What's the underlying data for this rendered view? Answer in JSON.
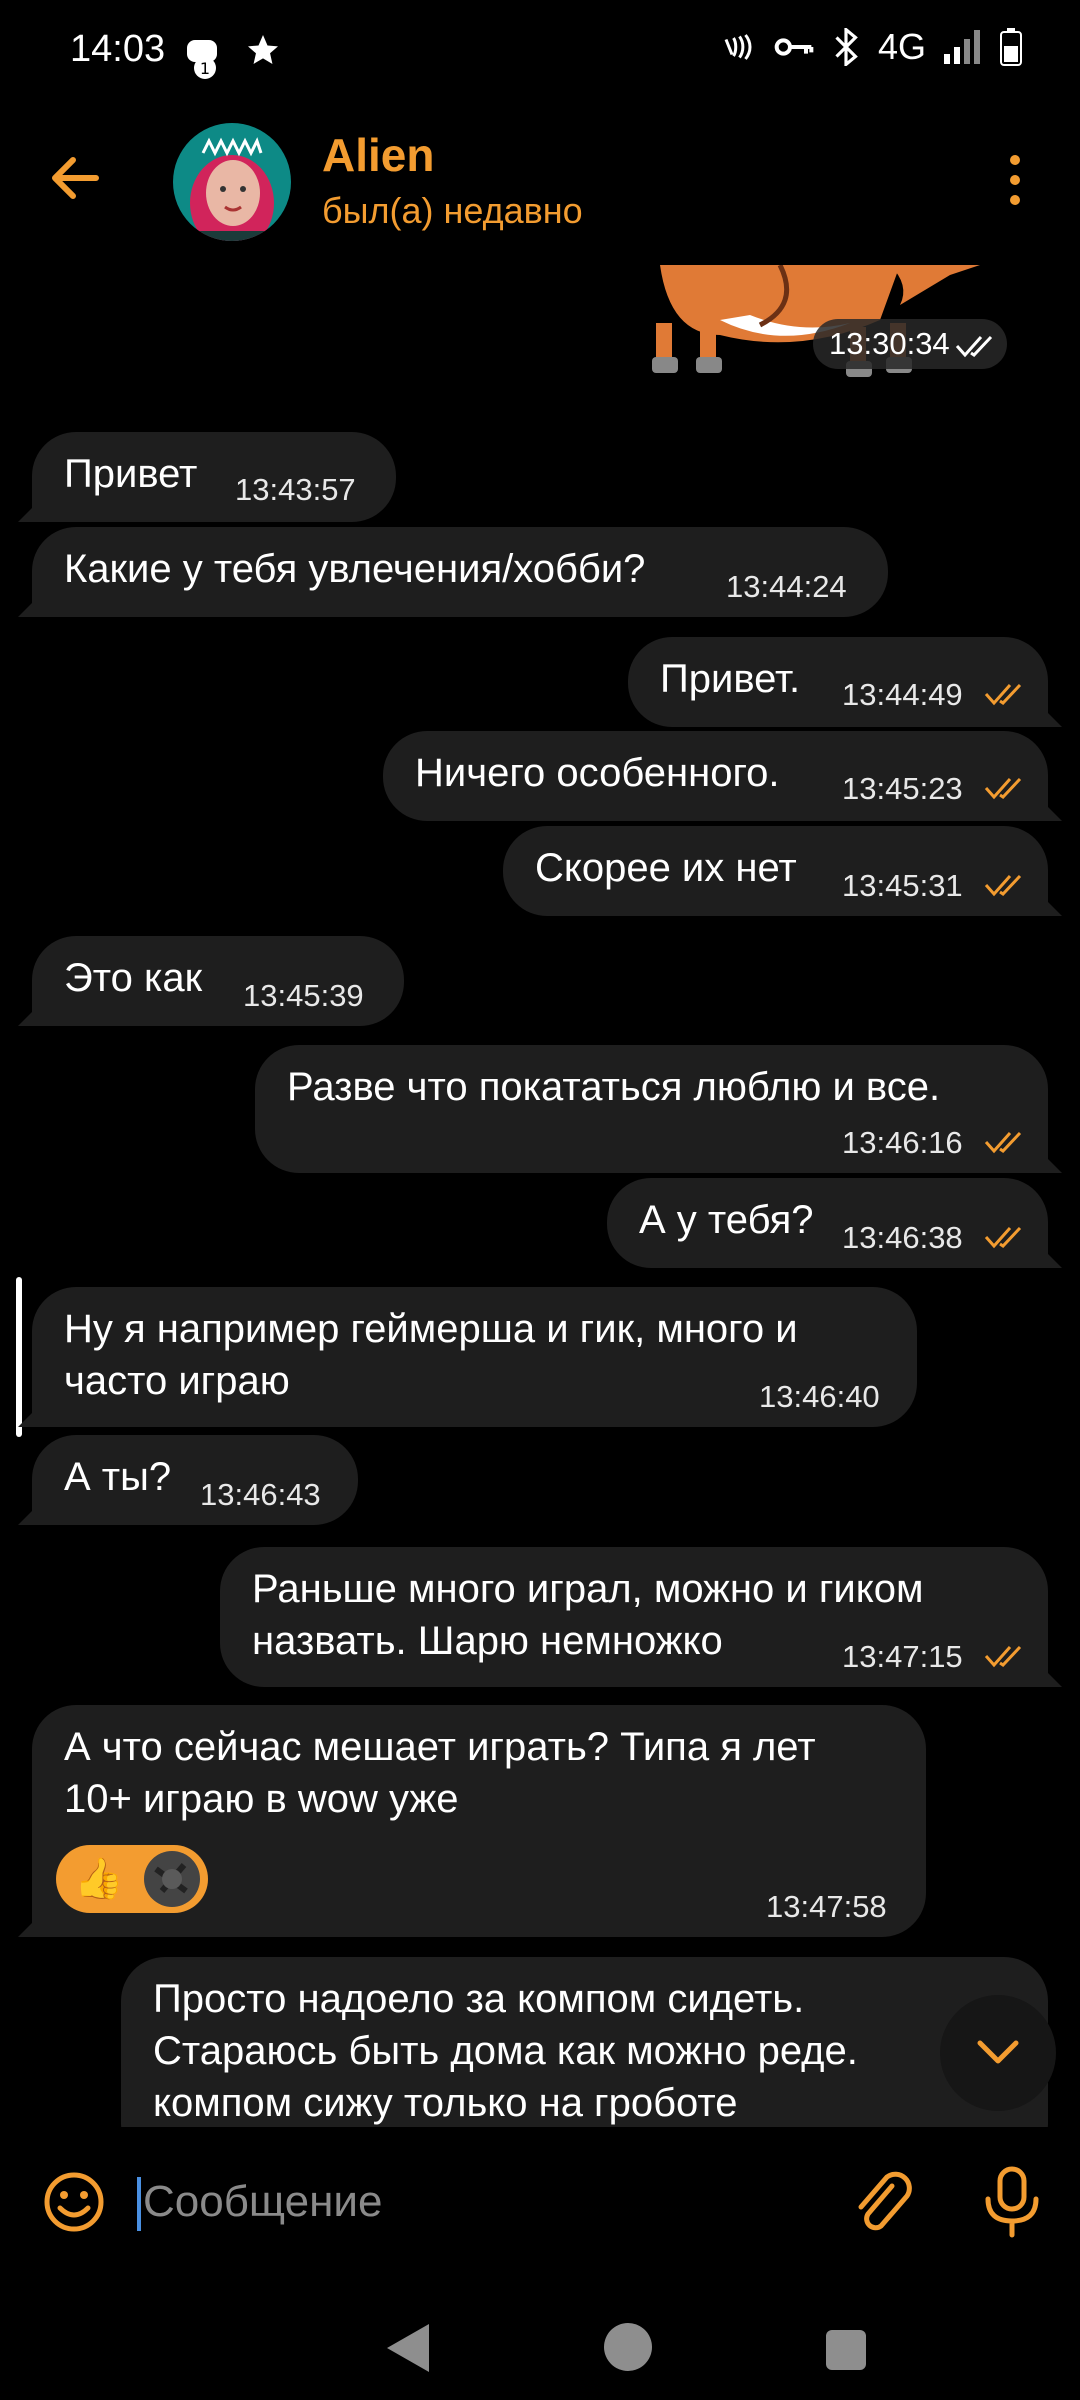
{
  "status_bar": {
    "time": "14:03",
    "network": "4G"
  },
  "header": {
    "name": "Alien",
    "status": "был(а) недавно"
  },
  "messages": [
    {
      "dir": "out",
      "text": "",
      "time": "13:30:34"
    },
    {
      "dir": "in",
      "text": "Привет",
      "time": "13:43:57"
    },
    {
      "dir": "in",
      "text": "Какие у тебя увлечения/хобби?",
      "time": "13:44:24"
    },
    {
      "dir": "out",
      "text": "Привет.",
      "time": "13:44:49"
    },
    {
      "dir": "out",
      "text": "Ничего особенного.",
      "time": "13:45:23"
    },
    {
      "dir": "out",
      "text": "Скорее их нет",
      "time": "13:45:31"
    },
    {
      "dir": "in",
      "text": "Это как",
      "time": "13:45:39"
    },
    {
      "dir": "out",
      "text": "Разве что покататься люблю и все.",
      "time": "13:46:16"
    },
    {
      "dir": "out",
      "text": "А у тебя?",
      "time": "13:46:38"
    },
    {
      "dir": "in",
      "line1": "Ну я например геймерша и гик, много и",
      "line2": "часто играю",
      "time": "13:46:40"
    },
    {
      "dir": "in",
      "text": "А ты?",
      "time": "13:46:43"
    },
    {
      "dir": "out",
      "line1": "Раньше много играл, можно и гиком",
      "line2": "назвать. Шарю немножко",
      "time": "13:47:15"
    },
    {
      "dir": "in",
      "line1": "А что сейчас мешает играть? Типа я лет",
      "line2": "10+ играю в wow уже",
      "time": "13:47:58"
    },
    {
      "dir": "out",
      "line1": "Просто надоело за компом сидеть.",
      "line2": "Стараюсь быть дома как можно реде.",
      "line3": "компом сижу только на гроботе"
    }
  ],
  "reaction": {
    "emoji": "👍"
  },
  "composer": {
    "placeholder": "Сообщение"
  },
  "colors": {
    "accent": "#f39c30",
    "bubble": "#1e1e1e",
    "background": "#000000"
  },
  "icons": [
    "back-arrow-icon",
    "more-vert-icon",
    "emoji-icon",
    "attach-icon",
    "mic-icon",
    "chevron-down-icon",
    "double-check-icon"
  ]
}
